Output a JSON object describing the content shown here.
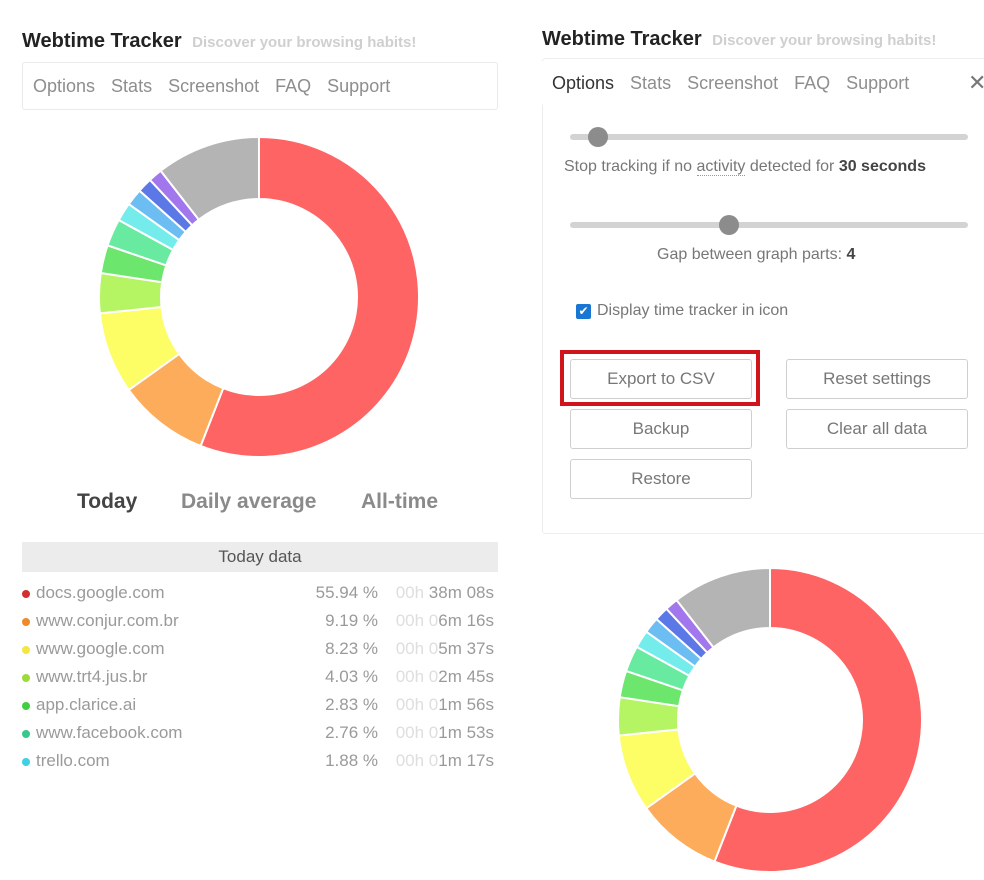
{
  "left": {
    "header": {
      "title": "Webtime Tracker",
      "subtitle": "Discover your browsing habits!"
    },
    "nav": [
      "Options",
      "Stats",
      "Screenshot",
      "FAQ",
      "Support"
    ],
    "tabs": [
      {
        "label": "Today",
        "active": true
      },
      {
        "label": "Daily average",
        "active": false
      },
      {
        "label": "All-time",
        "active": false
      }
    ],
    "data_header": "Today data",
    "rows": [
      {
        "site": "docs.google.com",
        "pct": "55.94 %",
        "time_zero": "00h ",
        "time": "38m 08s",
        "color": "#d32f2f"
      },
      {
        "site": "www.conjur.com.br",
        "pct": "9.19 %",
        "time_zero": "00h 0",
        "time": "6m 16s",
        "color": "#ef8a2c"
      },
      {
        "site": "www.google.com",
        "pct": "8.23 %",
        "time_zero": "00h 0",
        "time": "5m 37s",
        "color": "#f4e640"
      },
      {
        "site": "www.trt4.jus.br",
        "pct": "4.03 %",
        "time_zero": "00h 0",
        "time": "2m 45s",
        "color": "#9bdc3c"
      },
      {
        "site": "app.clarice.ai",
        "pct": "2.83 %",
        "time_zero": "00h 0",
        "time": "1m 56s",
        "color": "#3fcf3f"
      },
      {
        "site": "www.facebook.com",
        "pct": "2.76 %",
        "time_zero": "00h 0",
        "time": "1m 53s",
        "color": "#35c98a"
      },
      {
        "site": "trello.com",
        "pct": "1.88 %",
        "time_zero": "00h 0",
        "time": "1m 17s",
        "color": "#40d0e0"
      }
    ]
  },
  "right": {
    "header": {
      "title": "Webtime Tracker",
      "subtitle": "Discover your browsing habits!"
    },
    "nav": [
      "Options",
      "Stats",
      "Screenshot",
      "FAQ",
      "Support"
    ],
    "close_glyph": "✕",
    "settings": {
      "stop_tracking_prefix": "Stop tracking if no ",
      "stop_tracking_link": "activity",
      "stop_tracking_mid": " detected for ",
      "stop_tracking_value": "30 seconds",
      "stop_tracking_slider_fraction": 0.07,
      "gap_label": "Gap between graph parts: ",
      "gap_value": "4",
      "gap_slider_fraction": 0.4,
      "display_icon_label": "Display time tracker in icon",
      "display_icon_checked": true
    },
    "buttons": {
      "export_csv": "Export to CSV",
      "reset_settings": "Reset settings",
      "backup": "Backup",
      "clear_all": "Clear all data",
      "restore": "Restore"
    },
    "highlight_color": "#d0141c"
  },
  "chart_data": {
    "type": "pie",
    "segments": [
      {
        "label": "docs.google.com",
        "value": 55.94,
        "color": "#fe6464"
      },
      {
        "label": "www.conjur.com.br",
        "value": 9.19,
        "color": "#fdac5c"
      },
      {
        "label": "www.google.com",
        "value": 8.23,
        "color": "#fdfd66"
      },
      {
        "label": "www.trt4.jus.br",
        "value": 4.03,
        "color": "#b5f463"
      },
      {
        "label": "app.clarice.ai",
        "value": 2.83,
        "color": "#6ce66c"
      },
      {
        "label": "www.facebook.com",
        "value": 2.76,
        "color": "#68eaa0"
      },
      {
        "label": "trello.com",
        "value": 1.88,
        "color": "#75ecec"
      },
      {
        "label": "",
        "value": 1.7,
        "color": "#6cbdf2"
      },
      {
        "label": "",
        "value": 1.5,
        "color": "#5b78e6"
      },
      {
        "label": "",
        "value": 1.4,
        "color": "#a276ec"
      },
      {
        "label": "",
        "value": 10.53,
        "color": "#b4b4b4"
      }
    ]
  }
}
